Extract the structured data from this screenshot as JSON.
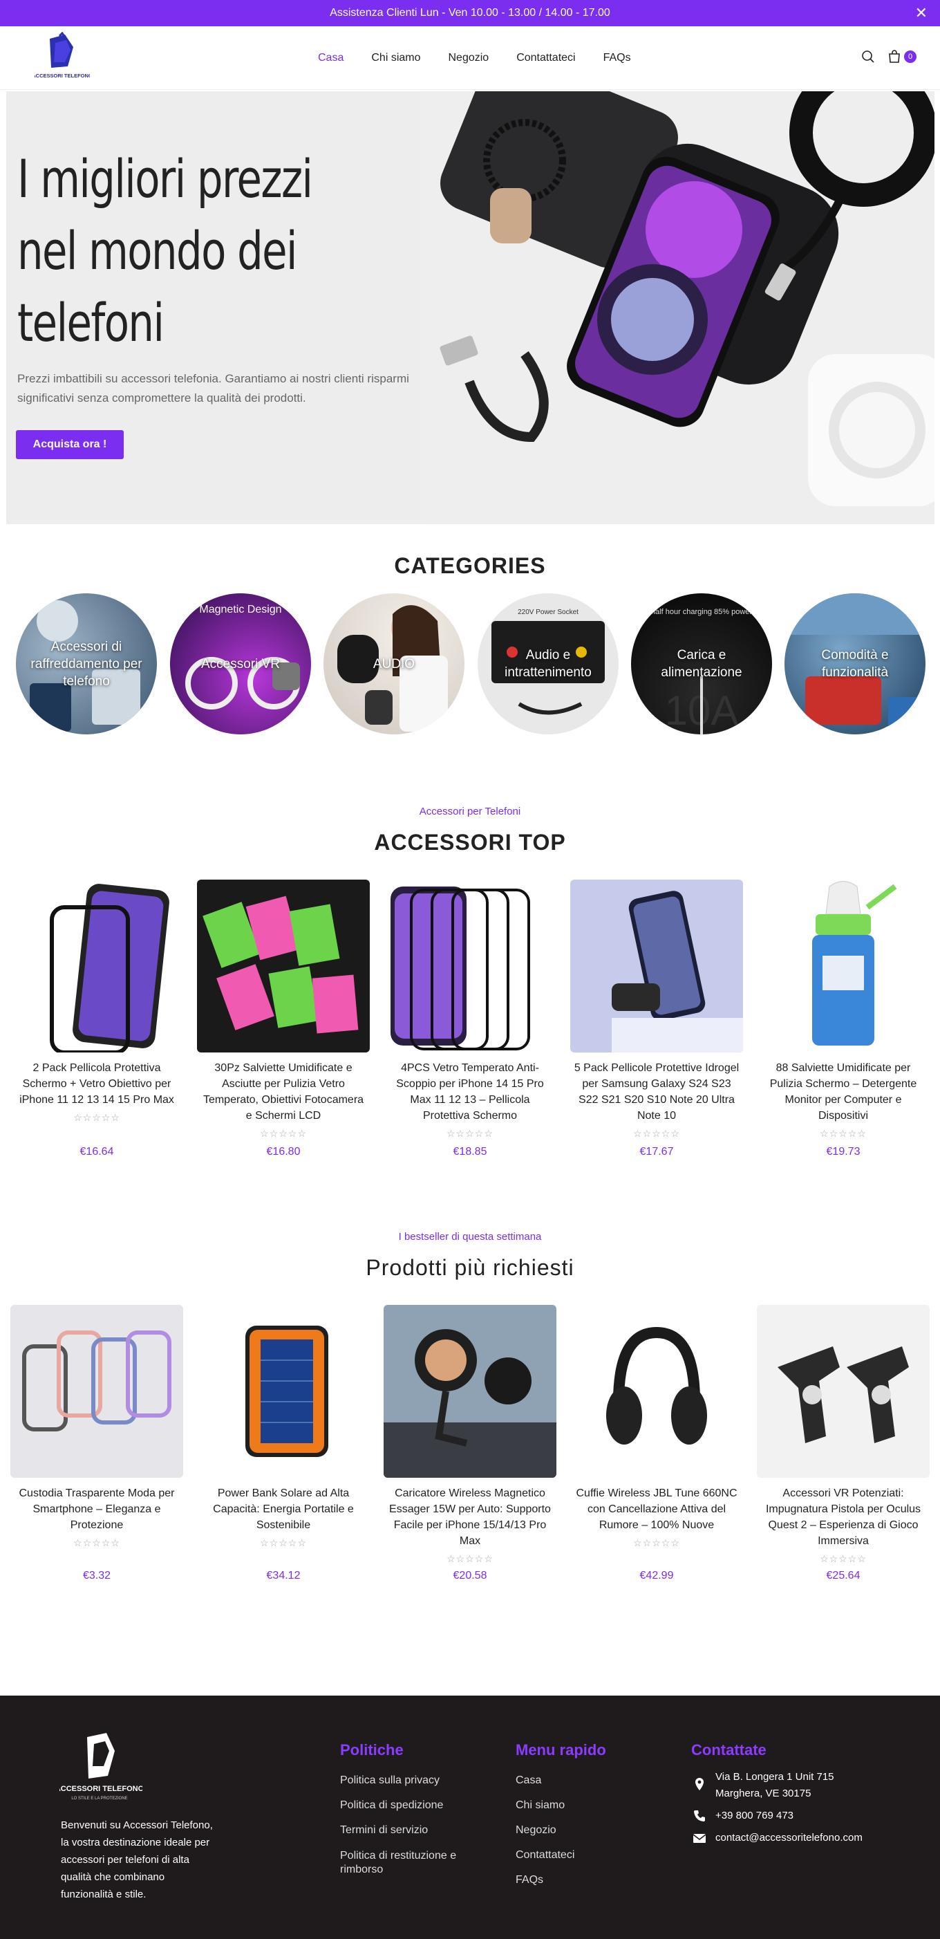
{
  "topbar": {
    "text": "Assistenza Clienti  Lun - Ven 10.00 - 13.00 / 14.00 - 17.00",
    "close": "✕"
  },
  "header": {
    "logo_text": "ACCESSORI TELEFONO",
    "nav": [
      "Casa",
      "Chi siamo",
      "Negozio",
      "Contattateci",
      "FAQs"
    ],
    "cart_count": "0"
  },
  "hero": {
    "title": "I migliori prezzi nel mondo dei telefoni",
    "text": "Prezzi imbattibili su accessori telefonia. Garantiamo ai nostri clienti risparmi significativi senza compromettere la qualità dei prodotti.",
    "button": "Acquista ora !"
  },
  "categories": {
    "title": "CATEGORIES",
    "items": [
      "Accessori di raffreddamento per telefono",
      "Accessori VR",
      "AUDIO",
      "Audio e intrattenimento",
      "Carica e alimentazione",
      "Comodità e funzionalità"
    ],
    "overlay_texts": [
      "Magnetic Design",
      "220V Power Socket",
      "half hour charging 85% power",
      "10A"
    ]
  },
  "top": {
    "subtitle": "Accessori per Telefoni",
    "title": "ACCESSORI TOP",
    "products": [
      {
        "name": "2 Pack Pellicola Protettiva Schermo + Vetro Obiettivo per iPhone 11 12 13 14 15 Pro Max",
        "price": "€16.64"
      },
      {
        "name": "30Pz Salviette Umidificate e Asciutte per Pulizia Vetro Temperato, Obiettivi Fotocamera e Schermi LCD",
        "price": "€16.80"
      },
      {
        "name": "4PCS Vetro Temperato Anti-Scoppio per iPhone 14 15 Pro Max 11 12 13 – Pellicola Protettiva Schermo",
        "price": "€18.85"
      },
      {
        "name": "5 Pack Pellicole Protettive Idrogel per Samsung Galaxy S24 S23 S22 S21 S20 S10 Note 20 Ultra Note 10",
        "price": "€17.67"
      },
      {
        "name": "88 Salviette Umidificate per Pulizia Schermo – Detergente Monitor per Computer e Dispositivi",
        "price": "€19.73"
      }
    ]
  },
  "best": {
    "subtitle": "I bestseller di questa settimana",
    "title": "Prodotti più richiesti",
    "products": [
      {
        "name": "Custodia Trasparente Moda per Smartphone – Eleganza e Protezione",
        "price": "€3.32"
      },
      {
        "name": "Power Bank Solare ad Alta Capacità: Energia Portatile e Sostenibile",
        "price": "€34.12"
      },
      {
        "name": "Caricatore Wireless Magnetico Essager 15W per Auto: Supporto Facile per iPhone 15/14/13 Pro Max",
        "price": "€20.58"
      },
      {
        "name": "Cuffie Wireless JBL Tune 660NC con Cancellazione Attiva del Rumore – 100% Nuove",
        "price": "€42.99"
      },
      {
        "name": "Accessori VR Potenziati: Impugnatura Pistola per Oculus Quest 2 – Esperienza di Gioco Immersiva",
        "price": "€25.64"
      }
    ]
  },
  "stars": "☆☆☆☆☆",
  "footer": {
    "logo_text": "ACCESSORI TELEFONO",
    "logo_tagline": "LO STILE E LA PROTEZIONE",
    "description": "Benvenuti su Accessori Telefono, la vostra destinazione ideale per accessori per telefoni di alta qualità che combinano funzionalità e stile.",
    "policies_title": "Politiche",
    "policies": [
      "Politica sulla privacy",
      "Politica di spedizione",
      "Termini di servizio",
      "Politica di restituzione e rimborso"
    ],
    "menu_title": "Menu rapido",
    "menu": [
      "Casa",
      "Chi siamo",
      "Negozio",
      "Contattateci",
      "FAQs"
    ],
    "contact_title": "Contattate",
    "address": "Via B. Longera 1 Unit 715 Marghera, VE 30175",
    "phone": "+39 800 769 473",
    "email": "contact@accessoritelefono.com"
  },
  "colors": {
    "accent": "#7b2df0",
    "footer_bg": "#1f1a1c"
  }
}
